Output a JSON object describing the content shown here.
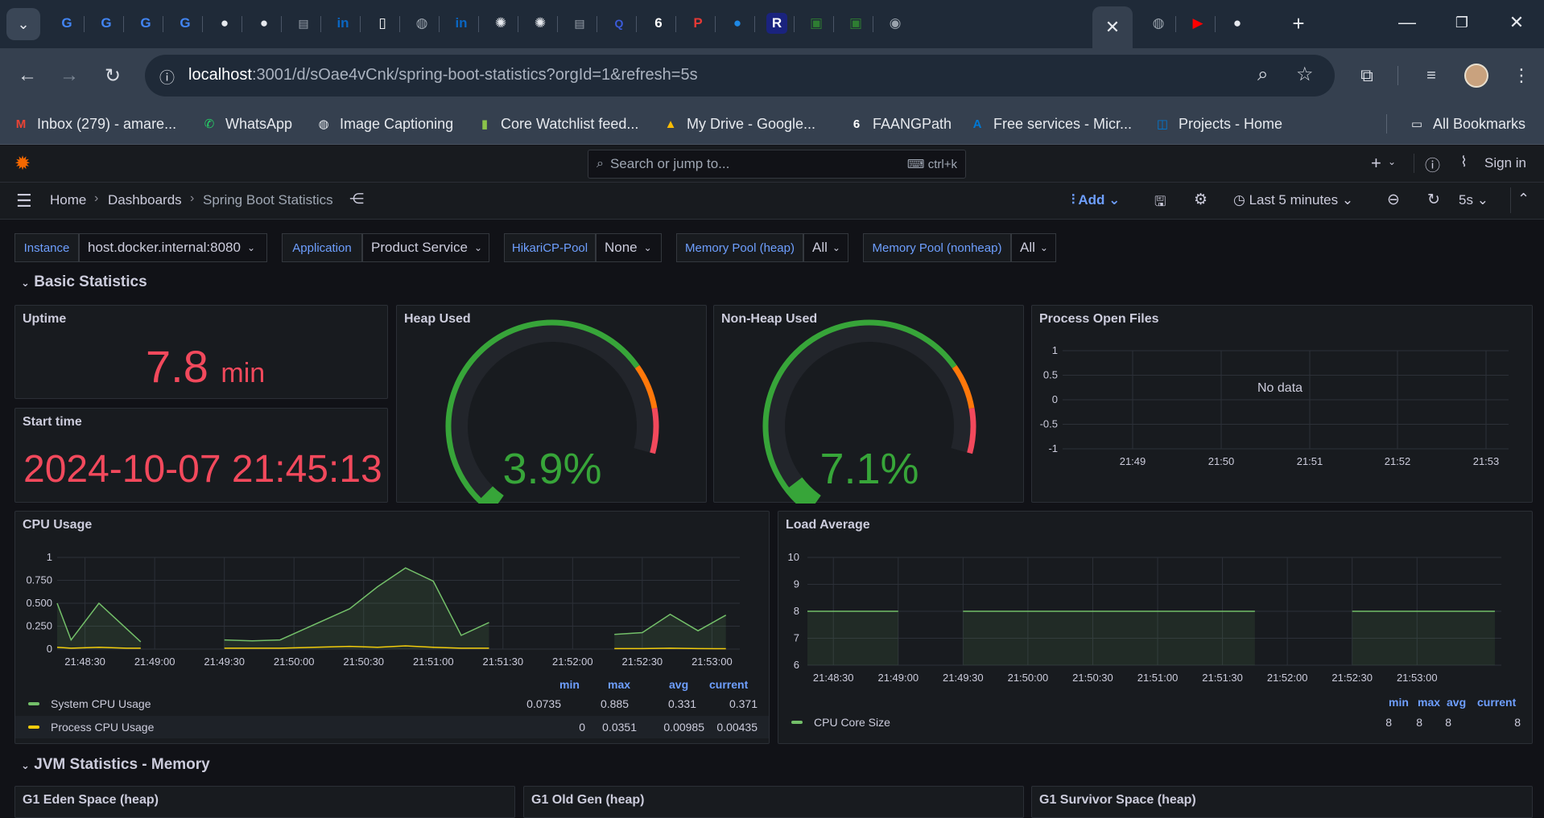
{
  "browser": {
    "url_host": "localhost",
    "url_rest": ":3001/d/sOae4vCnk/spring-boot-statistics?orgId=1&refresh=5s",
    "bookmarks": [
      {
        "label": "Inbox (279) - amare...",
        "icon": "gmail-icon",
        "glyph": "M",
        "color": "#ea4335"
      },
      {
        "label": "WhatsApp",
        "icon": "whatsapp-icon",
        "glyph": "✆",
        "color": "#25d366"
      },
      {
        "label": "Image Captioning",
        "icon": "globe-icon",
        "glyph": "◍",
        "color": "#e6e9ee"
      },
      {
        "label": "Core Watchlist feed...",
        "icon": "chart-bars-icon",
        "glyph": "▮",
        "color": "#8bc34a"
      },
      {
        "label": "My Drive - Google...",
        "icon": "google-drive-icon",
        "glyph": "▲",
        "color": "#fbbc04"
      },
      {
        "label": "FAANGPath",
        "icon": "faangpath-icon",
        "glyph": "6",
        "color": "#ffffff"
      },
      {
        "label": "Free services - Micr...",
        "icon": "azure-icon",
        "glyph": "A",
        "color": "#0078d4"
      },
      {
        "label": "Projects - Home",
        "icon": "azure-devops-icon",
        "glyph": "◫",
        "color": "#0078d4"
      }
    ],
    "all_bookmarks": "All Bookmarks"
  },
  "grafana": {
    "search_placeholder": "Search or jump to...",
    "search_shortcut": "ctrl+k",
    "sign_in": "Sign in",
    "breadcrumb": {
      "home": "Home",
      "dashboards": "Dashboards",
      "current": "Spring Boot Statistics"
    },
    "toolbar": {
      "add": "Add",
      "time_range": "Last 5 minutes",
      "refresh": "5s"
    },
    "variables": [
      {
        "label": "Instance",
        "value": "host.docker.internal:8080"
      },
      {
        "label": "Application",
        "value": "Product Service"
      },
      {
        "label": "HikariCP-Pool",
        "value": "None"
      },
      {
        "label": "Memory Pool (heap)",
        "value": "All"
      },
      {
        "label": "Memory Pool (nonheap)",
        "value": "All"
      }
    ],
    "rows": {
      "basic": "Basic Statistics",
      "jvm_memory": "JVM Statistics - Memory"
    },
    "panels": {
      "uptime": {
        "title": "Uptime",
        "value": "7.8",
        "unit": "min"
      },
      "start_time": {
        "title": "Start time",
        "value": "2024-10-07 21:45:13"
      },
      "heap": {
        "title": "Heap Used",
        "value": "3.9%"
      },
      "nonheap": {
        "title": "Non-Heap Used",
        "value": "7.1%"
      },
      "open_files": {
        "title": "Process Open Files",
        "no_data": "No data"
      },
      "cpu": {
        "title": "CPU Usage"
      },
      "load": {
        "title": "Load Average"
      },
      "eden": {
        "title": "G1 Eden Space (heap)"
      },
      "oldgen": {
        "title": "G1 Old Gen (heap)"
      },
      "survivor": {
        "title": "G1 Survivor Space (heap)"
      }
    },
    "legend_headers": {
      "min": "min",
      "max": "max",
      "avg": "avg",
      "current": "current"
    }
  },
  "colors": {
    "red": "#f2495c",
    "green": "#37a539",
    "series_green": "#73bf69",
    "series_yellow": "#f2cc0c",
    "orange": "#ff780a",
    "blue_text": "#6e9fff"
  },
  "chart_data": [
    {
      "type": "gauge",
      "title": "Heap Used",
      "value": 3.9,
      "unit": "%",
      "range": [
        0,
        100
      ],
      "thresholds": [
        {
          "from": 0,
          "color": "green"
        },
        {
          "from": 80,
          "color": "orange"
        },
        {
          "from": 90,
          "color": "red"
        }
      ]
    },
    {
      "type": "gauge",
      "title": "Non-Heap Used",
      "value": 7.1,
      "unit": "%",
      "range": [
        0,
        100
      ],
      "thresholds": [
        {
          "from": 0,
          "color": "green"
        },
        {
          "from": 80,
          "color": "orange"
        },
        {
          "from": 90,
          "color": "red"
        }
      ]
    },
    {
      "type": "line",
      "title": "Process Open Files",
      "x_ticks": [
        "21:49",
        "21:50",
        "21:51",
        "21:52",
        "21:53"
      ],
      "y_ticks": [
        "1",
        "0.5",
        "0",
        "-0.5",
        "-1"
      ],
      "ylim": [
        -1,
        1
      ],
      "series": []
    },
    {
      "type": "line",
      "title": "CPU Usage",
      "x": [
        "21:48:18",
        "21:48:24",
        "21:48:36",
        "21:48:48",
        "21:48:54",
        "21:49:30",
        "21:49:42",
        "21:49:54",
        "21:50:24",
        "21:50:36",
        "21:50:48",
        "21:51:00",
        "21:51:12",
        "21:51:24",
        "21:51:36",
        "21:52:18",
        "21:52:30",
        "21:52:42",
        "21:52:54",
        "21:53:06"
      ],
      "gap_after": [
        4,
        14
      ],
      "x_ticks": [
        "21:48:30",
        "21:49:00",
        "21:49:30",
        "21:50:00",
        "21:50:30",
        "21:51:00",
        "21:51:30",
        "21:52:00",
        "21:52:30",
        "21:53:00"
      ],
      "y_ticks": [
        "1",
        "0.750",
        "0.500",
        "0.250",
        "0"
      ],
      "ylim": [
        0,
        1
      ],
      "series": [
        {
          "name": "System CPU Usage",
          "color": "#73bf69",
          "values": [
            0.5,
            0.1,
            0.5,
            0.22,
            0.08,
            0.1,
            0.09,
            0.1,
            0.44,
            0.68,
            0.885,
            0.74,
            0.15,
            0.29,
            null,
            0.16,
            0.18,
            0.38,
            0.2,
            0.37
          ],
          "min": "0.0735",
          "max": "0.885",
          "avg": "0.331",
          "current": "0.371"
        },
        {
          "name": "Process CPU Usage",
          "color": "#f2cc0c",
          "values": [
            0.02,
            0.01,
            0.02,
            0.01,
            0.01,
            0.01,
            0.01,
            0.01,
            0.03,
            0.02,
            0.035,
            0.02,
            0.01,
            0.01,
            null,
            0.005,
            0.005,
            0.01,
            0.005,
            0.004
          ],
          "min": "0",
          "max": "0.0351",
          "avg": "0.00985",
          "current": "0.00435"
        }
      ]
    },
    {
      "type": "area",
      "title": "Load Average",
      "x_ticks": [
        "21:48:30",
        "21:49:00",
        "21:49:30",
        "21:50:00",
        "21:50:30",
        "21:51:00",
        "21:51:30",
        "21:52:00",
        "21:52:30",
        "21:53:00"
      ],
      "y_ticks": [
        "10",
        "9",
        "8",
        "7",
        "6"
      ],
      "ylim": [
        6,
        10
      ],
      "segments": [
        {
          "from": "21:48:18",
          "to": "21:49:00",
          "value": 8
        },
        {
          "from": "21:49:30",
          "to": "21:51:45",
          "value": 8
        },
        {
          "from": "21:52:30",
          "to": "21:53:36",
          "value": 8
        }
      ],
      "series": [
        {
          "name": "CPU Core Size",
          "color": "#73bf69",
          "min": "8",
          "max": "8",
          "avg": "8",
          "current": "8"
        }
      ]
    }
  ]
}
